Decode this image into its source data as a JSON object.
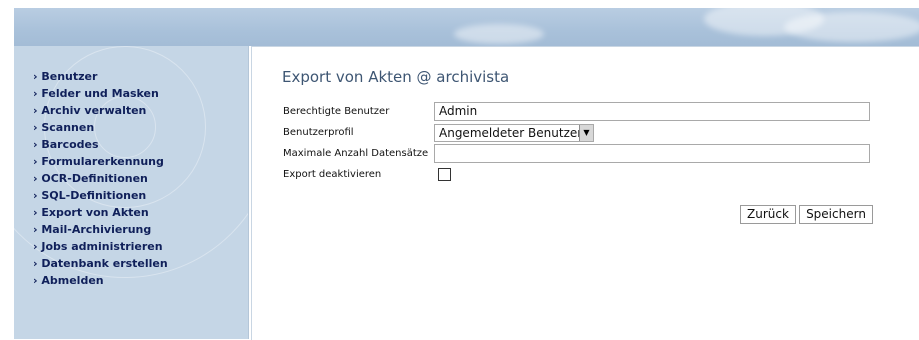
{
  "sidebar": {
    "items": [
      {
        "label": "› Benutzer"
      },
      {
        "label": "› Felder und Masken"
      },
      {
        "label": "› Archiv verwalten"
      },
      {
        "label": "› Scannen"
      },
      {
        "label": "› Barcodes"
      },
      {
        "label": "› Formularerkennung"
      },
      {
        "label": "› OCR-Definitionen"
      },
      {
        "label": "› SQL-Definitionen"
      },
      {
        "label": "› Export von Akten"
      },
      {
        "label": "› Mail-Archivierung"
      },
      {
        "label": "› Jobs administrieren"
      },
      {
        "label": "› Datenbank erstellen"
      },
      {
        "label": "› Abmelden"
      }
    ]
  },
  "main": {
    "title": "Export von Akten @ archivista",
    "form": {
      "users_label": "Berechtigte Benutzer",
      "users_value": "Admin",
      "profile_label": "Benutzerprofil",
      "profile_value": "Angemeldeter Benutzer",
      "max_label": "Maximale Anzahl Datensätze",
      "max_value": "",
      "disable_label": "Export deaktivieren",
      "disable_checked": false
    },
    "buttons": {
      "back": "Zurück",
      "save": "Speichern"
    }
  },
  "colors": {
    "nav_text": "#10205a",
    "title_text": "#3e5673",
    "sidebar_bg": "#c5d6e6",
    "header_bg": "#a9c1da"
  }
}
